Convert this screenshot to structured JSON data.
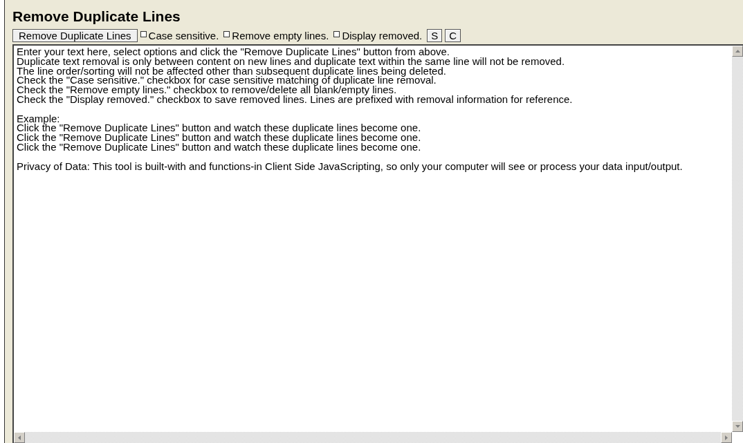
{
  "title": "Remove Duplicate Lines",
  "toolbar": {
    "action_button": "Remove Duplicate Lines",
    "checkboxes": [
      {
        "label": "Case sensitive.",
        "checked": false
      },
      {
        "label": "Remove empty lines.",
        "checked": false
      },
      {
        "label": "Display removed.",
        "checked": false
      }
    ],
    "small_buttons": [
      "S",
      "C"
    ]
  },
  "text_area": {
    "paragraphs": [
      [
        "Enter your text here, select options and click the \"Remove Duplicate Lines\" button from above.",
        "Duplicate text removal is only between content on new lines and duplicate text within the same line will not be removed.",
        "The line order/sorting will not be affected other than subsequent duplicate lines being deleted.",
        "Check the \"Case sensitive.\" checkbox for case sensitive matching of duplicate line removal.",
        "Check the \"Remove empty lines.\" checkbox to remove/delete all blank/empty lines.",
        "Check the \"Display removed.\" checkbox to save removed lines. Lines are prefixed with removal information for reference."
      ],
      [
        "Example:",
        "Click the \"Remove Duplicate Lines\" button and watch these duplicate lines become one.",
        "Click the \"Remove Duplicate Lines\" button and watch these duplicate lines become one.",
        "Click the \"Remove Duplicate Lines\" button and watch these duplicate lines become one."
      ],
      [
        "Privacy of Data: This tool is built-with and functions-in Client Side JavaScripting, so only your computer will see or process your data input/output."
      ]
    ]
  }
}
